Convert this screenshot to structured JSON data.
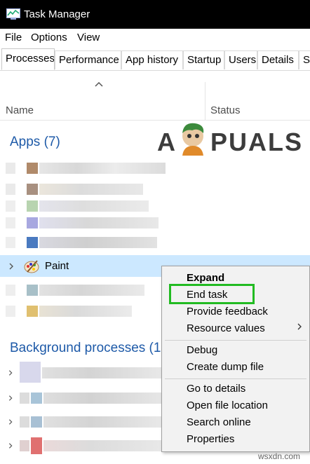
{
  "window": {
    "title": "Task Manager"
  },
  "menu": [
    "File",
    "Options",
    "View"
  ],
  "tabs": [
    "Processes",
    "Performance",
    "App history",
    "Startup",
    "Users",
    "Details",
    "Services"
  ],
  "columns": {
    "name": "Name",
    "status": "Status"
  },
  "groups": {
    "apps": "Apps (7)",
    "background": "Background processes (1"
  },
  "selected_process": {
    "label": "Paint"
  },
  "context_menu": {
    "items": [
      "Expand",
      "End task",
      "Provide feedback",
      "Resource values",
      "Debug",
      "Create dump file",
      "Go to details",
      "Open file location",
      "Search online",
      "Properties"
    ]
  },
  "watermark": {
    "left": "A",
    "right": "PUALS"
  },
  "credit": "wsxdn.com",
  "colors": {
    "accent": "#1e5aa8",
    "selection": "#cce8ff",
    "highlight_box": "#22bb22"
  }
}
